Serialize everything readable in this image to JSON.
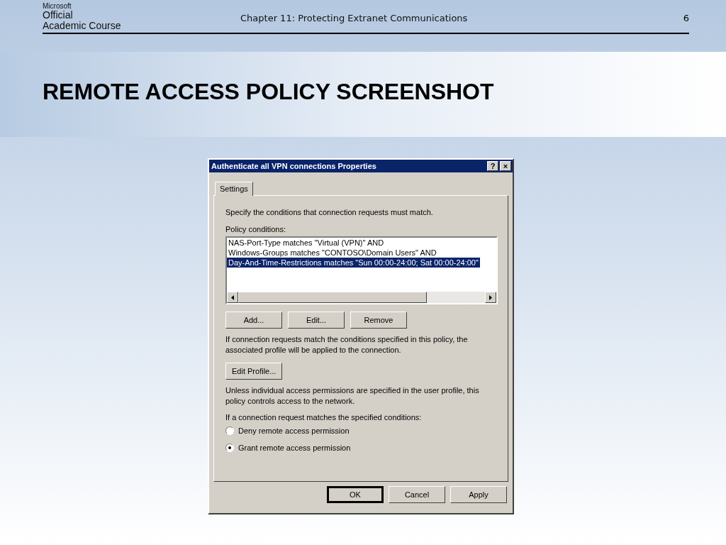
{
  "header": {
    "logo": {
      "brand": "Microsoft",
      "line_1": "Official",
      "line_2": "Academic Course"
    },
    "chapter": "Chapter 11: Protecting Extranet Communications",
    "page_number": "6"
  },
  "slide_title": "REMOTE ACCESS POLICY SCREENSHOT",
  "dialog": {
    "title": "Authenticate all VPN connections Properties",
    "title_buttons": [
      "?",
      "×"
    ],
    "tabs": [
      {
        "label": "Settings",
        "selected": true
      }
    ],
    "intro": "Specify the conditions that connection requests must match.",
    "conditions_label": "Policy conditions:",
    "conditions": [
      {
        "text": "NAS-Port-Type matches \"Virtual (VPN)\" AND",
        "selected": false
      },
      {
        "text": "Windows-Groups matches \"CONTOSO\\Domain Users\" AND",
        "selected": false
      },
      {
        "text": "Day-And-Time-Restrictions matches \"Sun 00:00-24:00; Sat 00:00-24:00\"",
        "selected": true
      }
    ],
    "condition_buttons": [
      "Add...",
      "Edit...",
      "Remove"
    ],
    "profile_note": "If connection requests match the conditions specified in this policy, the associated profile will be applied to the connection.",
    "profile_button": "Edit Profile...",
    "permission_note": "Unless individual access permissions are specified in the user profile, this policy controls access to the network.",
    "match_label": "If a connection request matches the specified conditions:",
    "options": [
      {
        "label": "Deny remote access permission",
        "selected": false
      },
      {
        "label": "Grant remote access permission",
        "selected": true
      }
    ],
    "footer_buttons": [
      {
        "label": "OK",
        "default": true
      },
      {
        "label": "Cancel",
        "default": false
      },
      {
        "label": "Apply",
        "default": false
      }
    ]
  }
}
